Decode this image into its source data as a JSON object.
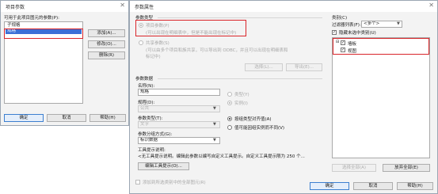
{
  "project_params_dialog": {
    "title": "项目参数",
    "list_label": "可用于此项目图元的参数(P):",
    "list_items": [
      "子规格",
      "规格"
    ],
    "btn_add": "添加(A)...",
    "btn_modify": "修改(O)...",
    "btn_delete": "删除(R)",
    "btn_ok": "确定",
    "btn_cancel": "取消",
    "btn_help": "帮助(H)"
  },
  "param_props_dialog": {
    "title": "参数属性",
    "param_type_group": "参数类型",
    "project_param_label": "项目参数(P)",
    "project_param_desc": "(可以出现在明细表中，但是不能出现在标记中)",
    "shared_param_label": "共享参数(S)",
    "shared_param_desc1": "(可以由多个项目和族共享，可以导出到 ODBC，并且可以出现在明细表和",
    "shared_param_desc2": "标记中)",
    "btn_select": "选择(L)...",
    "btn_export": "导出(E)...",
    "param_data_group": "参数数据",
    "name_label": "名称(N):",
    "name_value": "规格",
    "discipline_label": "规程(D):",
    "discipline_value": "公共",
    "param_type_label": "参数类型(T):",
    "param_type_value": "文字",
    "group_param_label": "参数分组方式(G):",
    "group_param_value": "标识数据",
    "type_radio": "类型(Y)",
    "instance_radio": "实例(I)",
    "align_by_group": "按组类型对齐值(A)",
    "vary_by_group": "值可能因组实例而不同(V)",
    "tooltip_label": "工具提示说明:",
    "tooltip_text": "<无工具提示说明。编辑此参数以编写自定义工具提示。自定义工具提示限为 250 个...",
    "btn_edit_tooltip": "编辑工具提示(O)...",
    "add_to_all": "添加到所选类别中的全部图元(R)",
    "categories_label": "类别(C)",
    "filter_label": "过滤器列表(F):",
    "filter_value": "<多个>",
    "hide_unchecked": "隐藏未选中类别(U)",
    "cat_items": [
      {
        "label": "墙板",
        "checked": true
      },
      {
        "label": "视图",
        "checked": true
      }
    ],
    "btn_select_all": "选择全部(A)",
    "btn_deselect_all": "放弃全部(E)",
    "btn_ok": "确定",
    "btn_cancel": "取消",
    "btn_help": "帮助(H)"
  },
  "colors": {
    "accent": "#3c7fd0",
    "highlight_red": "#d9252a",
    "selection_blue": "#3b6fd6"
  }
}
